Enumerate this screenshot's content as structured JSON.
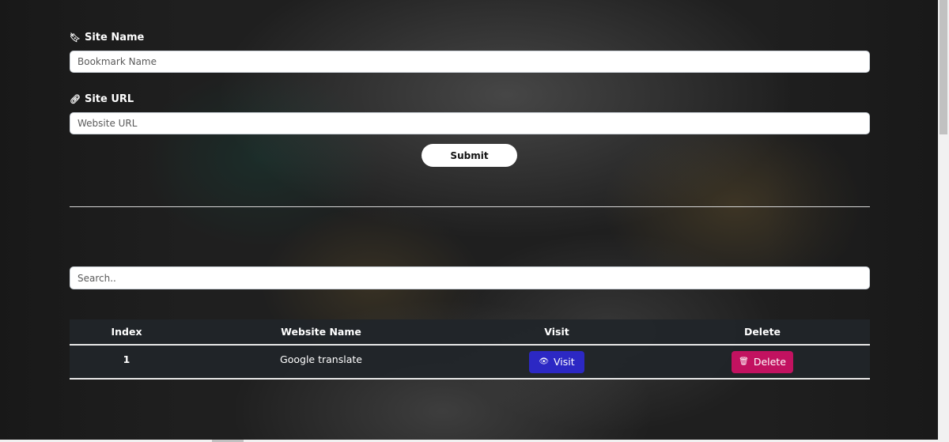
{
  "form": {
    "site_name_icon": "bookmark-icon",
    "site_name_label": "Site Name",
    "site_name_placeholder": "Bookmark Name",
    "site_url_icon": "link-icon",
    "site_url_label": "Site URL",
    "site_url_placeholder": "Website URL",
    "submit_label": "Submit"
  },
  "search": {
    "placeholder": "Search.."
  },
  "table": {
    "headers": [
      "Index",
      "Website Name",
      "Visit",
      "Delete"
    ],
    "rows": [
      {
        "index": "1",
        "name": "Google translate",
        "visit_label": "Visit",
        "visit_icon": "eye-icon",
        "delete_label": "Delete",
        "delete_icon": "trash-icon"
      }
    ]
  },
  "colors": {
    "visit_button": "#2c28c4",
    "delete_button": "#c21260",
    "page_background": "#1e1f20"
  }
}
